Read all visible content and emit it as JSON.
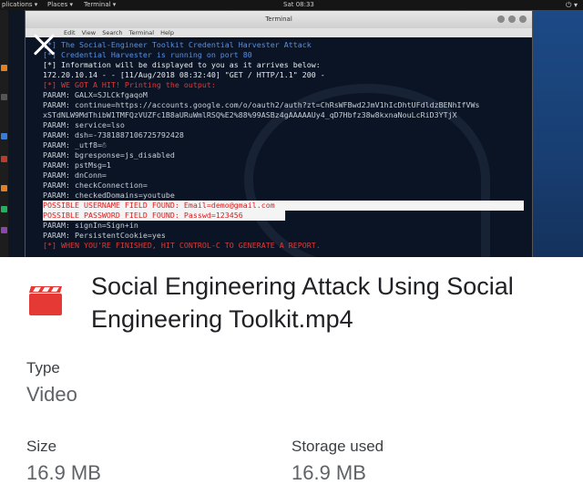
{
  "preview": {
    "topbar": {
      "applications": "plications ▾",
      "places": "Places ▾",
      "terminal_menu": "Terminal ▾",
      "clock": "Sat 08:33"
    },
    "terminal": {
      "window_title": "Terminal",
      "menu": [
        "Edit",
        "View",
        "Search",
        "Terminal",
        "Help"
      ],
      "lines": [
        {
          "text": "[*] The Social-Engineer Toolkit Credential Harvester Attack",
          "style": "blue"
        },
        {
          "text": "[*] Credential Harvester is running on port 80",
          "style": "blue"
        },
        {
          "text": "[*] Information will be displayed to you as it arrives below:",
          "style": "white"
        },
        {
          "text": "172.20.10.14 - - [11/Aug/2018 08:32:40] \"GET / HTTP/1.1\" 200 -",
          "style": "white"
        },
        {
          "text": "[*] WE GOT A HIT! Printing the output:",
          "style": "red"
        },
        {
          "text": "PARAM: GALX=SJLCkfgaqoM",
          "style": "normal"
        },
        {
          "text": "PARAM: continue=https://accounts.google.com/o/oauth2/auth?zt=ChRsWFBwd2JmV1hIcDhtUFdldzBENhIfVWs",
          "style": "normal"
        },
        {
          "text": "xSTdNLW9MdThibW1TMFQzVUZFc1B8aURuWmlRSQ%E2%88%99ASBz4gAAAAAUy4_qD7Hbfz38w8kxnaNouLcRiD3YTjX",
          "style": "normal"
        },
        {
          "text": "PARAM: service=lso",
          "style": "normal"
        },
        {
          "text": "PARAM: dsh=-7381887106725792428",
          "style": "normal"
        },
        {
          "text": "PARAM: _utf8=☃",
          "style": "normal"
        },
        {
          "text": "PARAM: bgresponse=js_disabled",
          "style": "normal"
        },
        {
          "text": "PARAM: pstMsg=1",
          "style": "normal"
        },
        {
          "text": "PARAM: dnConn=",
          "style": "normal"
        },
        {
          "text": "PARAM: checkConnection=",
          "style": "normal"
        },
        {
          "text": "PARAM: checkedDomains=youtube",
          "style": "normal"
        },
        {
          "text": "POSSIBLE USERNAME FIELD FOUND: Email=demo@gmail.com",
          "style": "highlight"
        },
        {
          "text": "POSSIBLE PASSWORD FIELD FOUND: Passwd=123456",
          "style": "highlight"
        },
        {
          "text": "PARAM: signIn=Sign+in",
          "style": "normal"
        },
        {
          "text": "PARAM: PersistentCookie=yes",
          "style": "normal"
        },
        {
          "text": "[*] WHEN YOU'RE FINISHED, HIT CONTROL-C TO GENERATE A REPORT.",
          "style": "red"
        }
      ]
    }
  },
  "file": {
    "icon": "video-file-icon",
    "icon_color": "#e53935",
    "title": "Social Engineering Attack Using Social Engineering Toolkit.mp4"
  },
  "details": {
    "type_label": "Type",
    "type_value": "Video",
    "size_label": "Size",
    "size_value": "16.9 MB",
    "storage_label": "Storage used",
    "storage_value": "16.9 MB"
  },
  "colors": {
    "accent_red": "#e53935",
    "terminal_bg": "#0a1424"
  }
}
